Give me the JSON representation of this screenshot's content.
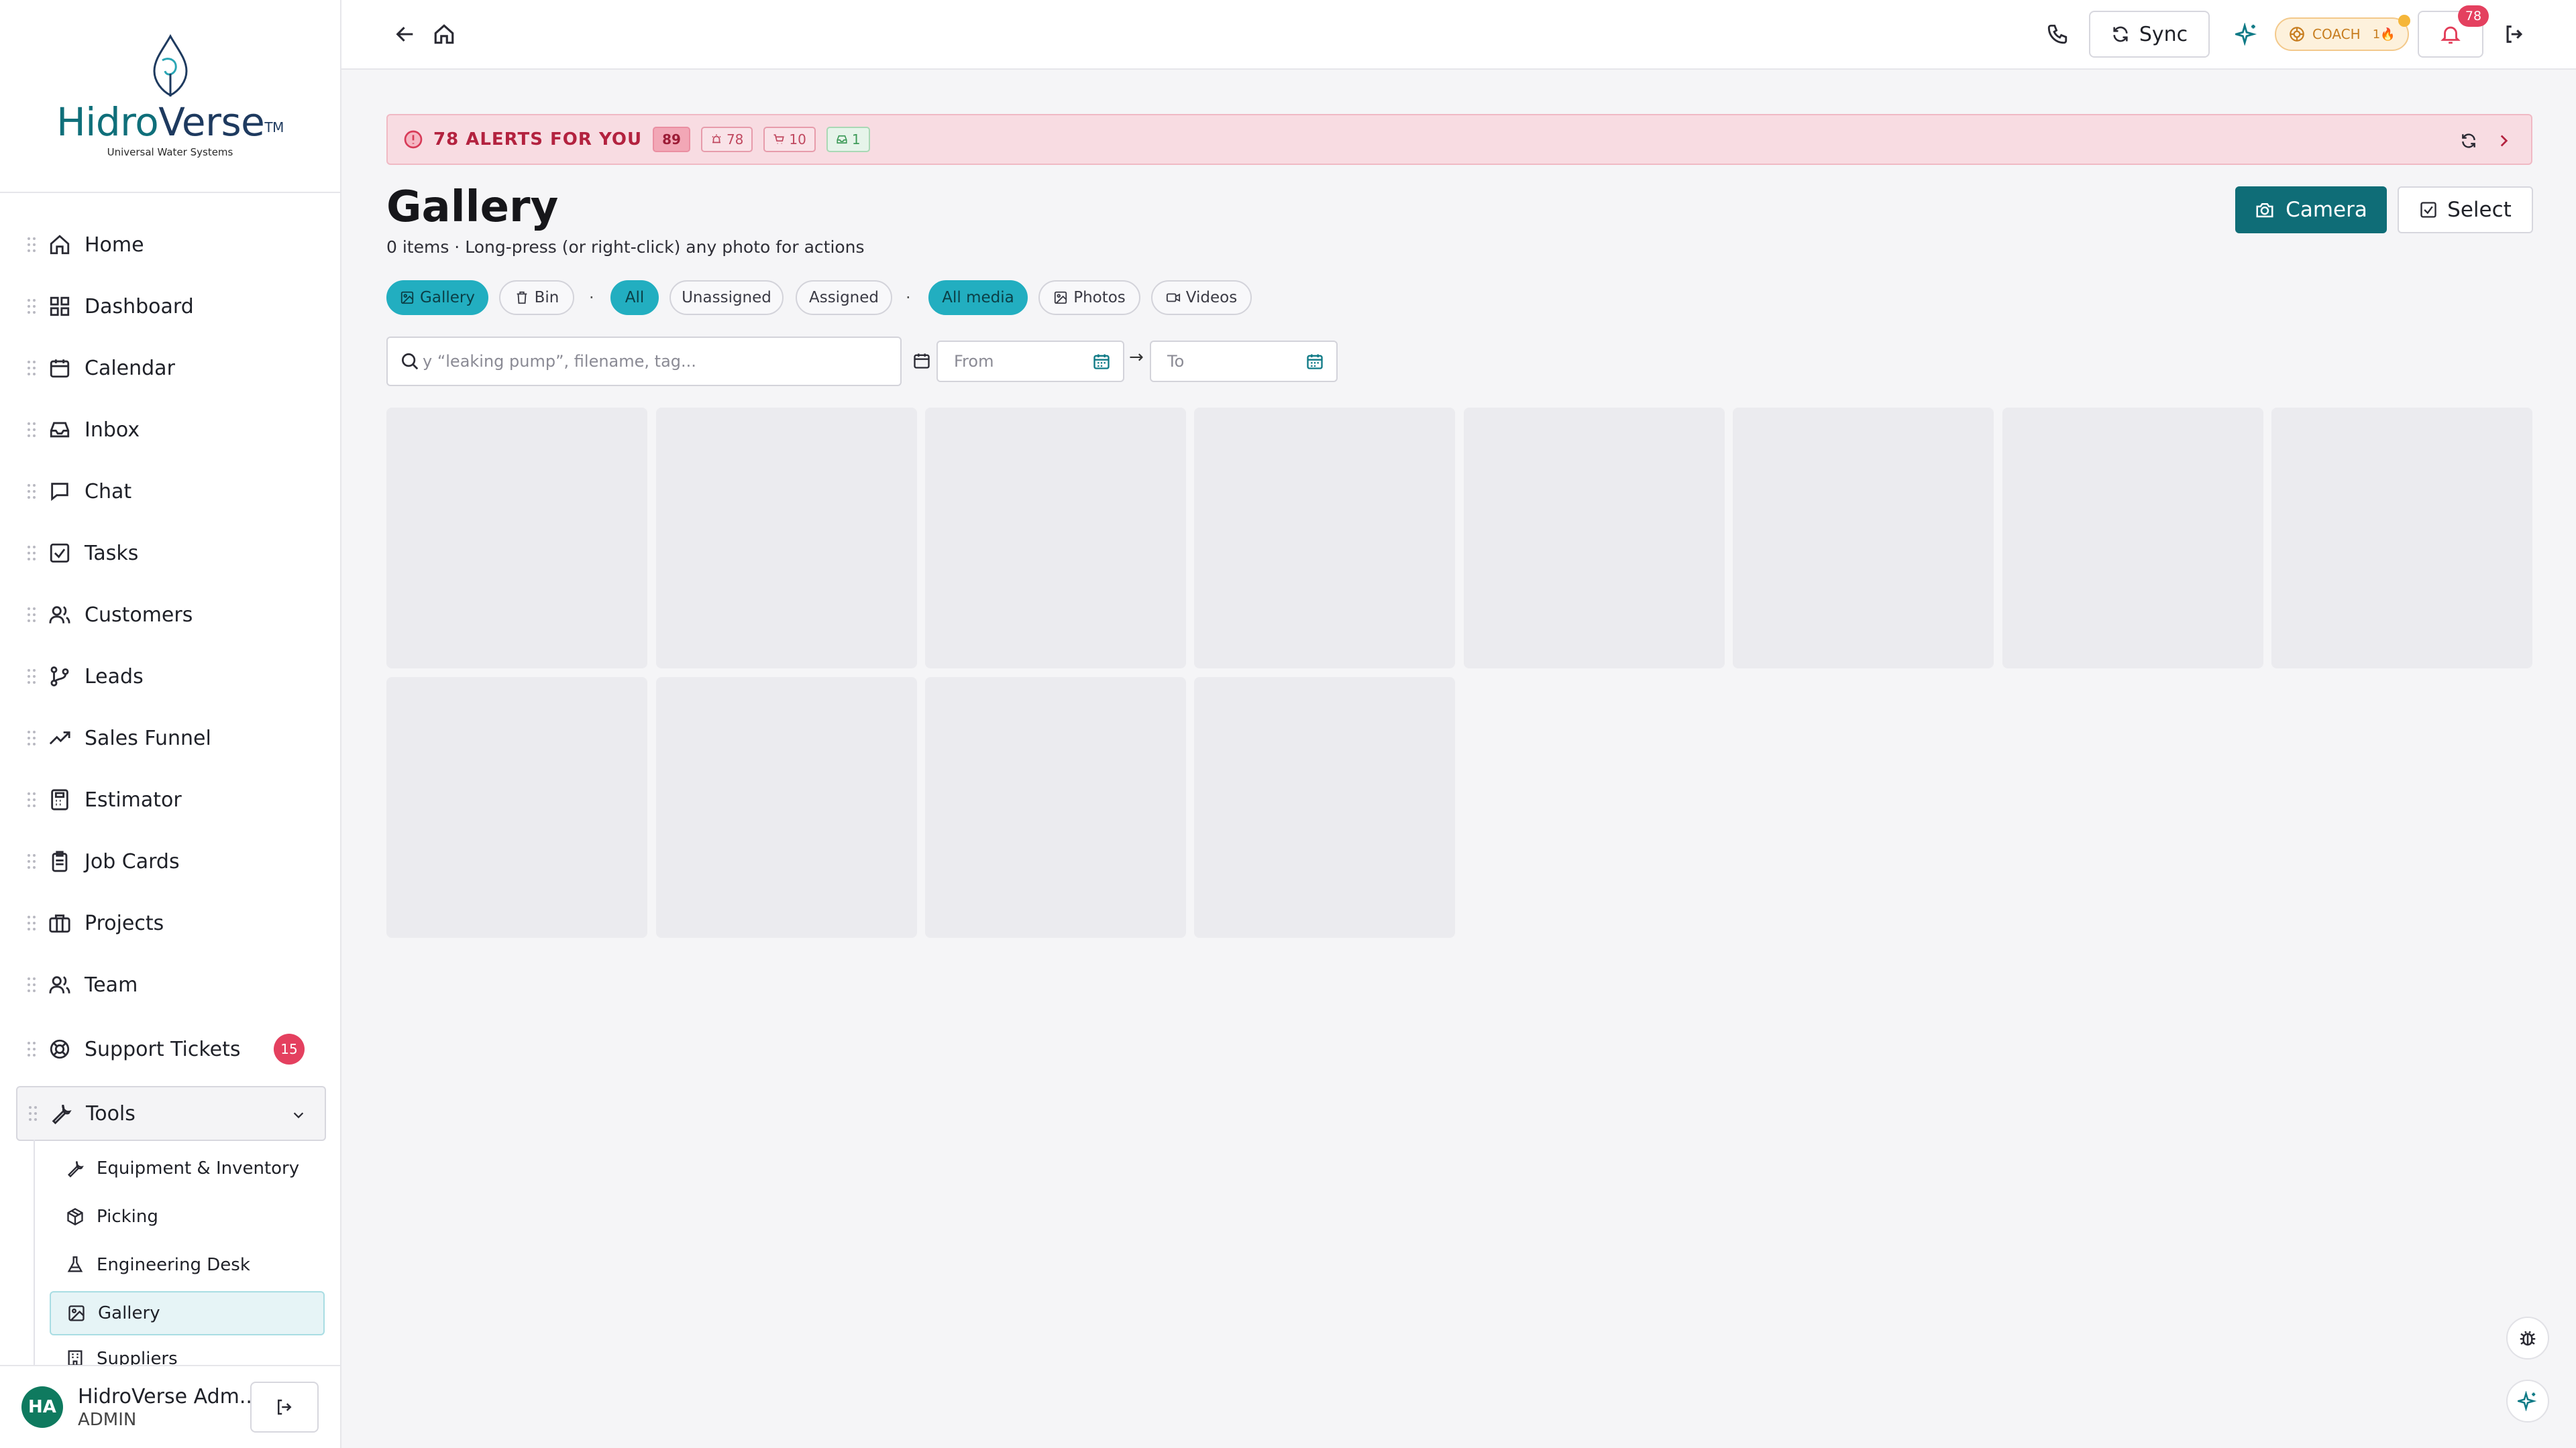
{
  "brand": {
    "name_part1": "Hidro",
    "name_part2": "Verse",
    "trademark": "TM",
    "tagline": "Universal Water Systems"
  },
  "sidebar": {
    "items": [
      {
        "label": "Home",
        "icon": "home-icon"
      },
      {
        "label": "Dashboard",
        "icon": "dashboard-icon"
      },
      {
        "label": "Calendar",
        "icon": "calendar-icon"
      },
      {
        "label": "Inbox",
        "icon": "inbox-icon"
      },
      {
        "label": "Chat",
        "icon": "chat-icon"
      },
      {
        "label": "Tasks",
        "icon": "tasks-icon"
      },
      {
        "label": "Customers",
        "icon": "customers-icon"
      },
      {
        "label": "Leads",
        "icon": "leads-icon"
      },
      {
        "label": "Sales Funnel",
        "icon": "trending-up-icon"
      },
      {
        "label": "Estimator",
        "icon": "calculator-icon"
      },
      {
        "label": "Job Cards",
        "icon": "clipboard-icon"
      },
      {
        "label": "Projects",
        "icon": "briefcase-icon"
      },
      {
        "label": "Team",
        "icon": "team-icon"
      },
      {
        "label": "Support Tickets",
        "icon": "lifebuoy-icon",
        "badge": "15"
      },
      {
        "label": "Tools",
        "icon": "wrench-icon",
        "expanded": true
      }
    ],
    "tools_sub": [
      {
        "label": "Equipment & Inventory",
        "icon": "wrench-icon"
      },
      {
        "label": "Picking",
        "icon": "package-icon"
      },
      {
        "label": "Engineering Desk",
        "icon": "flask-icon"
      },
      {
        "label": "Gallery",
        "icon": "image-icon",
        "active": true
      },
      {
        "label": "Suppliers",
        "icon": "building-icon"
      }
    ],
    "user": {
      "initials": "HA",
      "name": "HidroVerse Adm...",
      "role": "ADMIN"
    }
  },
  "topbar": {
    "sync_label": "Sync",
    "coach_label": "COACH",
    "coach_count": "1🔥",
    "notifications_count": "78"
  },
  "alerts": {
    "title": "78 ALERTS FOR YOU",
    "total": "89",
    "counts": {
      "first": "78",
      "second": "10",
      "third": "1"
    }
  },
  "page": {
    "title": "Gallery",
    "subtitle": "0 items · Long-press (or right-click) any photo for actions",
    "camera_label": "Camera",
    "select_label": "Select"
  },
  "filters": {
    "view": [
      "Gallery",
      "Bin"
    ],
    "assignment": [
      "All",
      "Unassigned",
      "Assigned"
    ],
    "media": [
      "All media",
      "Photos",
      "Videos"
    ],
    "separator": "·",
    "selected": {
      "view": "Gallery",
      "assignment": "All",
      "media": "All media"
    }
  },
  "search": {
    "placeholder": "y “leaking pump”, filename, tag..."
  },
  "date_range": {
    "from_placeholder": "From",
    "to_placeholder": "To",
    "arrow": "→"
  },
  "gallery": {
    "placeholder_tiles": 12
  },
  "colors": {
    "accent": "#0f6d77",
    "chip_selected": "#22aec0",
    "alert_bg": "#f8dce2",
    "badge": "#e4405f"
  }
}
